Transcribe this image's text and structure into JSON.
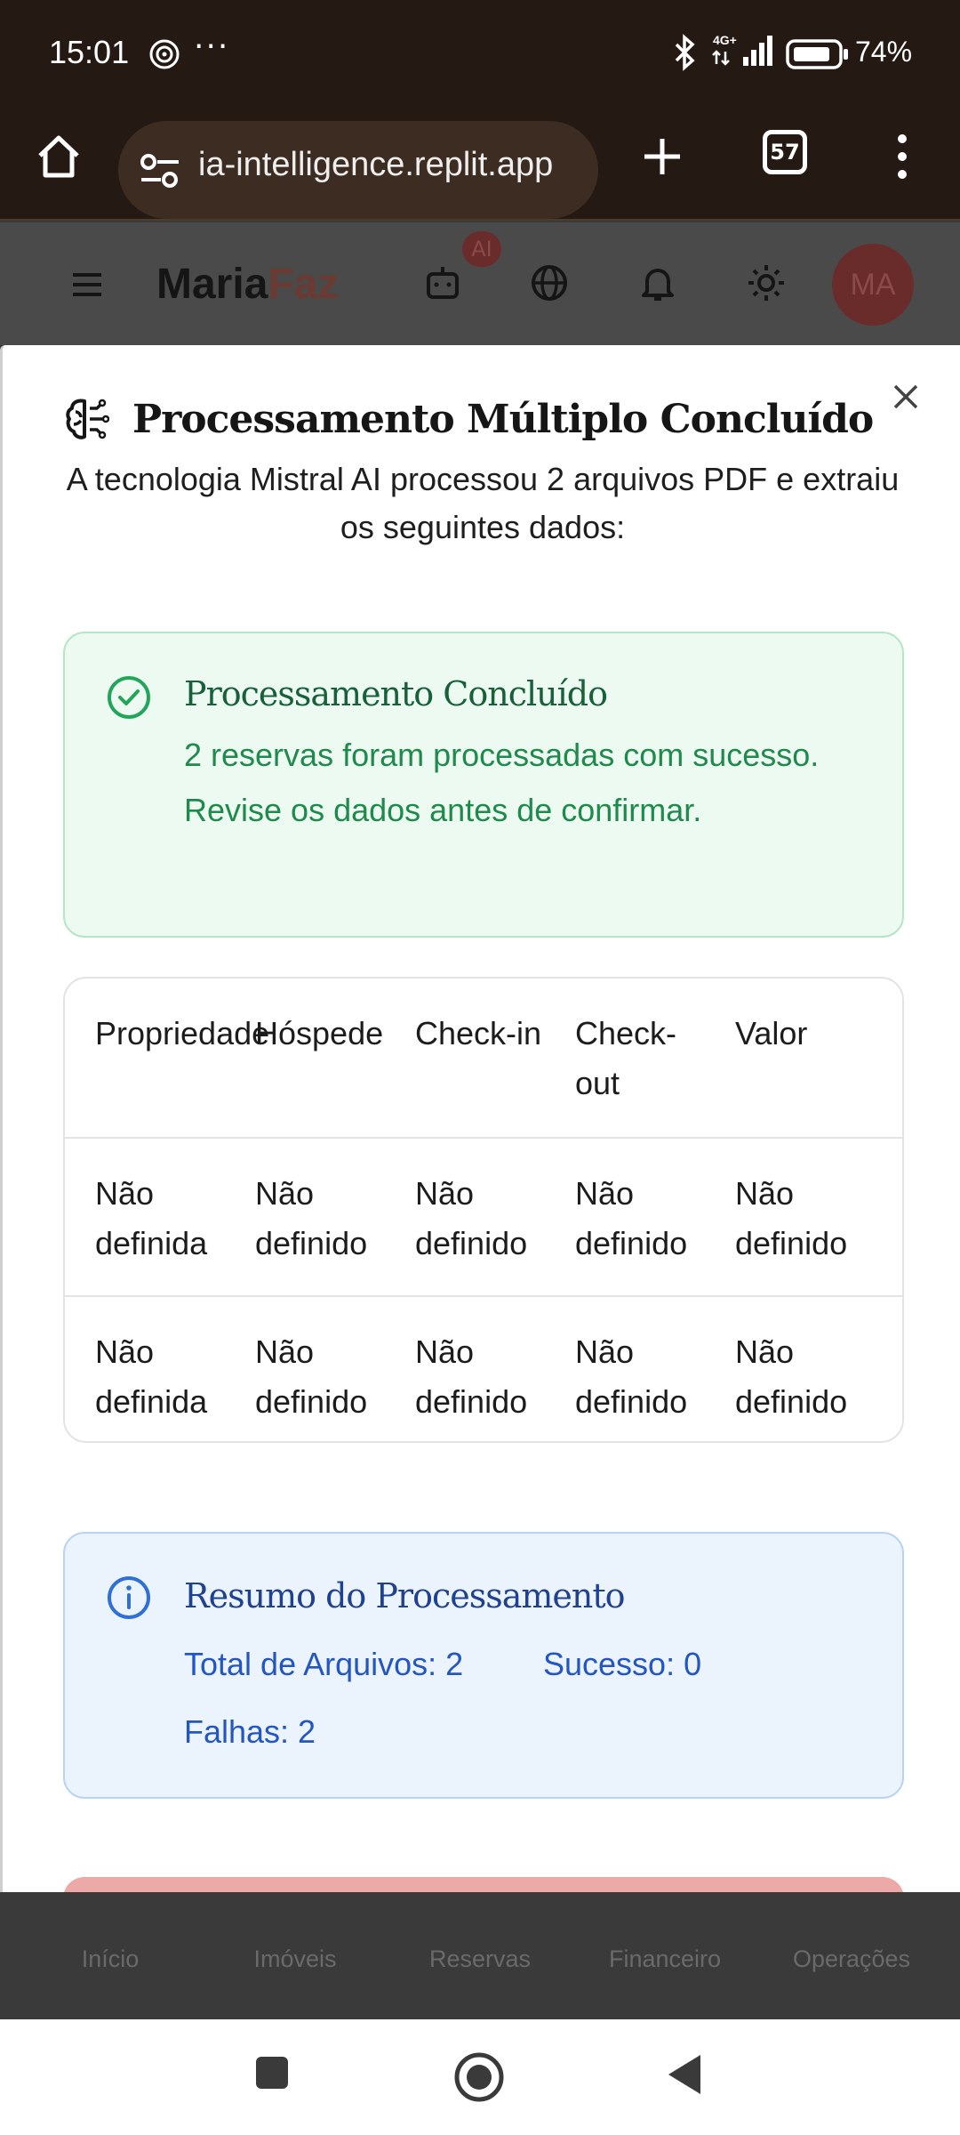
{
  "status_bar": {
    "time": "15:01",
    "dots": "···",
    "battery_pct": "74%",
    "network": "4G+"
  },
  "browser": {
    "url": "ia-intelligence.replit.app",
    "tab_count": "57"
  },
  "app_header": {
    "logo_main": "Maria",
    "logo_accent": "Faz",
    "ai_badge": "AI",
    "avatar_initials": "MA"
  },
  "modal": {
    "title": "Processamento Múltiplo Concluído",
    "description": "A tecnologia Mistral AI processou 2 arquivos PDF e extraiu os seguintes dados:",
    "success": {
      "title": "Processamento Concluído",
      "message": "2 reservas foram processadas com sucesso. Revise os dados antes de confirmar."
    },
    "table": {
      "headers": [
        "Propriedade",
        "Hóspede",
        "Check-in",
        "Check-out",
        "Valor"
      ],
      "rows": [
        [
          "Não definida",
          "Não definido",
          "Não definido",
          "Não definido",
          "Não definido"
        ],
        [
          "Não definida",
          "Não definido",
          "Não definido",
          "Não definido",
          "Não definido"
        ]
      ]
    },
    "summary": {
      "title": "Resumo do Processamento",
      "total_files": "Total de Arquivos: 2",
      "success": "Sucesso: 0",
      "failures": "Falhas: 2"
    }
  },
  "bottom_nav": {
    "items": [
      "Início",
      "Imóveis",
      "Reservas",
      "Financeiro",
      "Operações"
    ]
  },
  "colors": {
    "success_text": "#1f8a4c",
    "info_text": "#2456c2",
    "brand_accent": "#6a2c2a",
    "browser_bg": "#251914"
  }
}
